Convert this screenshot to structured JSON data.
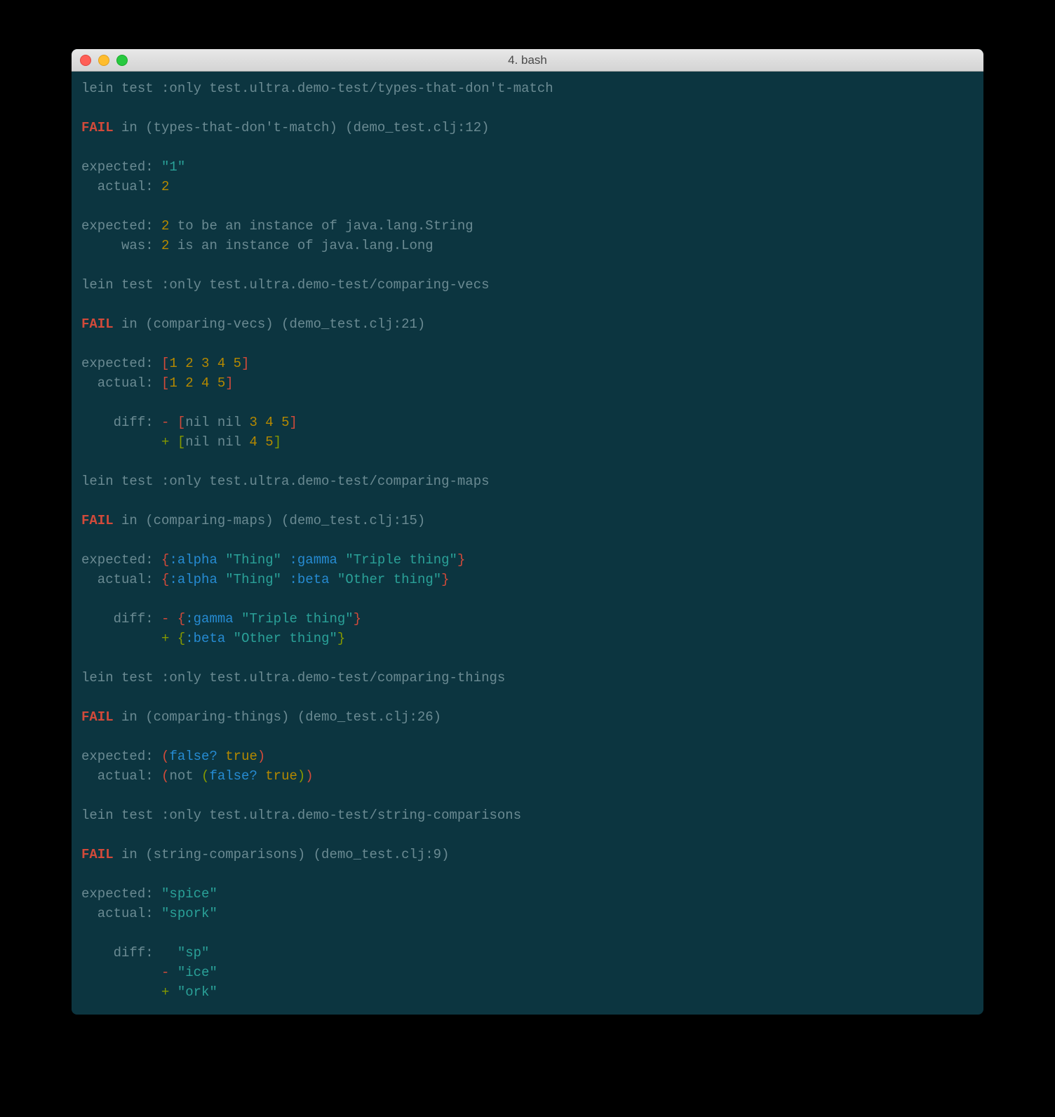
{
  "window": {
    "title": "4. bash"
  },
  "t": {
    "l1": "lein test :only test.ultra.demo-test/types-that-don't-match",
    "l3a": "FAIL",
    "l3b": " in (types-that-don't-match) (demo_test.clj:12)",
    "l5a": "expected: ",
    "l5b": "\"1\"",
    "l6a": "  actual: ",
    "l6b": "2",
    "l8a": "expected: ",
    "l8b": "2",
    "l8c": " to be an instance of java.lang.String",
    "l9a": "     was: ",
    "l9b": "2",
    "l9c": " is an instance of java.lang.Long",
    "l11": "lein test :only test.ultra.demo-test/comparing-vecs",
    "l13a": "FAIL",
    "l13b": " in (comparing-vecs) (demo_test.clj:21)",
    "l15a": "expected: ",
    "l15b": "[",
    "l15c": "1 2 3 4 5",
    "l15d": "]",
    "l16a": "  actual: ",
    "l16b": "[",
    "l16c": "1 2 4 5",
    "l16d": "]",
    "l18a": "    diff: ",
    "l18b": "-",
    "l18c": " ",
    "l18d": "[",
    "l18e": "nil nil ",
    "l18f": "3 4 5",
    "l18g": "]",
    "l19a": "          ",
    "l19b": "+",
    "l19c": " ",
    "l19d": "[",
    "l19e": "nil nil ",
    "l19f": "4 5",
    "l19g": "]",
    "l21": "lein test :only test.ultra.demo-test/comparing-maps",
    "l23a": "FAIL",
    "l23b": " in (comparing-maps) (demo_test.clj:15)",
    "l25a": "expected: ",
    "l25b": "{",
    "l25c": ":alpha",
    "l25d": " ",
    "l25e": "\"Thing\"",
    "l25f": " ",
    "l25g": ":gamma",
    "l25h": " ",
    "l25i": "\"Triple thing\"",
    "l25j": "}",
    "l26a": "  actual: ",
    "l26b": "{",
    "l26c": ":alpha",
    "l26d": " ",
    "l26e": "\"Thing\"",
    "l26f": " ",
    "l26g": ":beta",
    "l26h": " ",
    "l26i": "\"Other thing\"",
    "l26j": "}",
    "l28a": "    diff: ",
    "l28b": "-",
    "l28c": " ",
    "l28d": "{",
    "l28e": ":gamma",
    "l28f": " ",
    "l28g": "\"Triple thing\"",
    "l28h": "}",
    "l29a": "          ",
    "l29b": "+",
    "l29c": " ",
    "l29d": "{",
    "l29e": ":beta",
    "l29f": " ",
    "l29g": "\"Other thing\"",
    "l29h": "}",
    "l31": "lein test :only test.ultra.demo-test/comparing-things",
    "l33a": "FAIL",
    "l33b": " in (comparing-things) (demo_test.clj:26)",
    "l35a": "expected: ",
    "l35b": "(",
    "l35c": "false?",
    "l35d": " ",
    "l35e": "true",
    "l35f": ")",
    "l36a": "  actual: ",
    "l36b": "(",
    "l36c": "not ",
    "l36d": "(",
    "l36e": "false?",
    "l36f": " ",
    "l36g": "true",
    "l36h": ")",
    "l36i": ")",
    "l38": "lein test :only test.ultra.demo-test/string-comparisons",
    "l40a": "FAIL",
    "l40b": " in (string-comparisons) (demo_test.clj:9)",
    "l42a": "expected: ",
    "l42b": "\"spice\"",
    "l43a": "  actual: ",
    "l43b": "\"spork\"",
    "l45a": "    diff:   ",
    "l45b": "\"sp\"",
    "l46a": "          ",
    "l46b": "-",
    "l46c": " ",
    "l46d": "\"ice\"",
    "l47a": "          ",
    "l47b": "+",
    "l47c": " ",
    "l47d": "\"ork\""
  }
}
